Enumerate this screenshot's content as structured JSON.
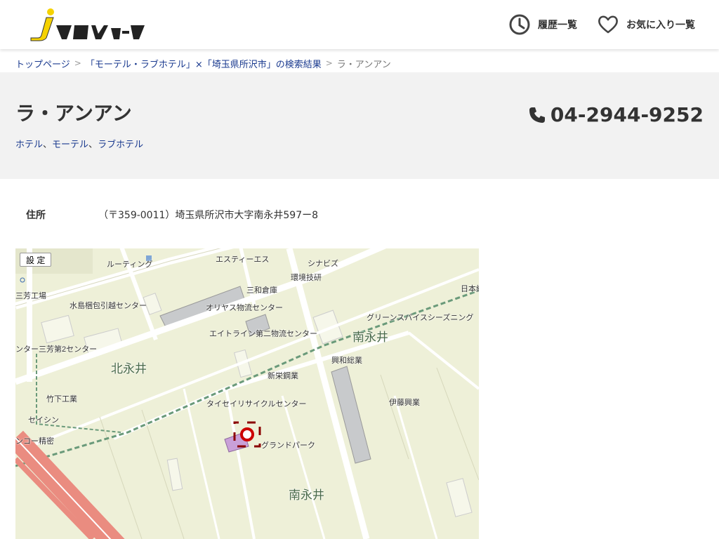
{
  "header": {
    "logo_text": "iタウンページ",
    "history_label": "履歴一覧",
    "favorites_label": "お気に入り一覧"
  },
  "breadcrumb": {
    "home": "トップページ",
    "search": "「モーテル・ラブホテル」×「埼玉県所沢市」の検索結果",
    "current": "ラ・アンアン",
    "separator": ">"
  },
  "listing": {
    "name": "ラ・アンアン",
    "categories": [
      "ホテル",
      "モーテル",
      "ラブホテル"
    ],
    "category_separator": "、",
    "phone": "04-2944-9252",
    "address_label": "住所",
    "address": "（〒359-0011）埼玉県所沢市大字南永井597ー8"
  },
  "map": {
    "settings_button": "設 定",
    "areas": [
      "南永井",
      "北永井",
      "南永井"
    ],
    "places": [
      "エスティーエス",
      "シナビズ",
      "ルーティング",
      "環境技研",
      "三和倉庫",
      "日本網",
      "三芳工場",
      "水島梱包引越センター",
      "オリヤス物流センター",
      "グリーンスパイスシーズニング",
      "エイトライン第二物流センター",
      "ンター三芳第2センター",
      "興和総業",
      "新栄鋼業",
      "竹下工業",
      "伊藤興業",
      "タイセイリサイクルセンター",
      "セイシン",
      "ンコー精密",
      "グランドパーク"
    ]
  },
  "colors": {
    "link": "#1a3a8f",
    "title_bg": "#f2f2f2",
    "map_bg": "#eef0d8",
    "marker": "#cc0000",
    "logo_yellow": "#f5d200"
  }
}
